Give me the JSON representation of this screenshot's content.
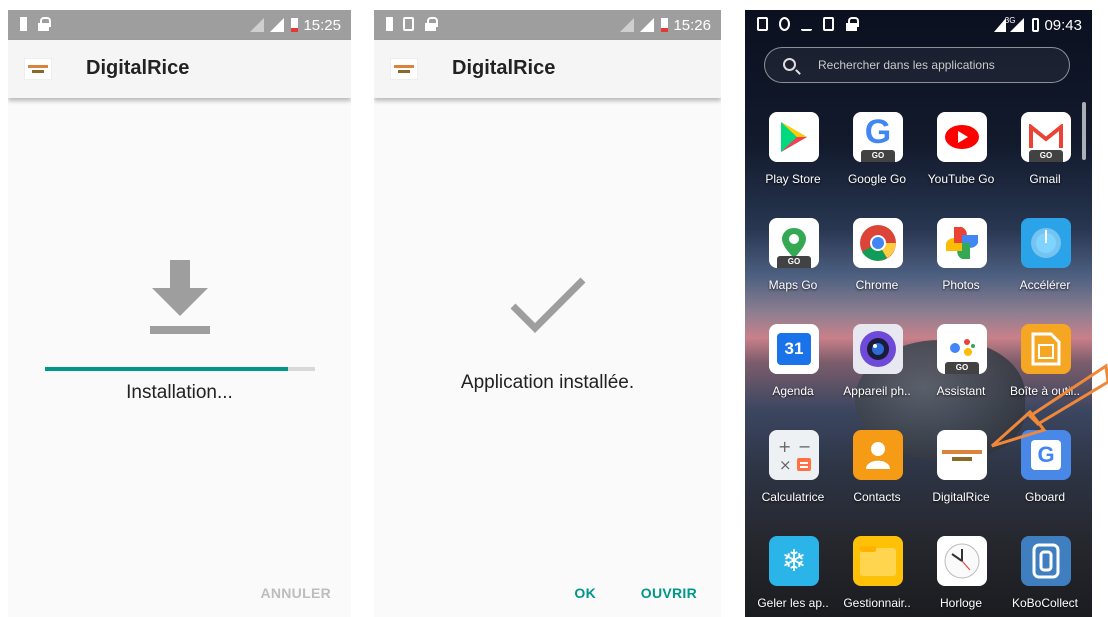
{
  "screen1": {
    "status_time": "15:25",
    "app_title": "DigitalRice",
    "status_message": "Installation...",
    "progress": 0.9,
    "cancel_label": "ANNULER"
  },
  "screen2": {
    "status_time": "15:26",
    "app_title": "DigitalRice",
    "status_message": "Application installée.",
    "ok_label": "OK",
    "open_label": "OUVRIR"
  },
  "screen3": {
    "status_time": "09:43",
    "network_label": "3G",
    "search_placeholder": "Rechercher dans les applications",
    "apps": [
      {
        "label": "Play Store",
        "icon": "play-store-icon"
      },
      {
        "label": "Google Go",
        "icon": "google-go-icon",
        "badge": "GO"
      },
      {
        "label": "YouTube Go",
        "icon": "youtube-go-icon"
      },
      {
        "label": "Gmail",
        "icon": "gmail-icon",
        "badge": "GO"
      },
      {
        "label": "Maps Go",
        "icon": "maps-go-icon",
        "badge": "GO"
      },
      {
        "label": "Chrome",
        "icon": "chrome-icon"
      },
      {
        "label": "Photos",
        "icon": "photos-icon"
      },
      {
        "label": "Accélérer",
        "icon": "accelerate-icon"
      },
      {
        "label": "Agenda",
        "icon": "calendar-icon",
        "badge": "31"
      },
      {
        "label": "Appareil ph..",
        "icon": "camera-icon"
      },
      {
        "label": "Assistant",
        "icon": "assistant-icon",
        "badge": "GO"
      },
      {
        "label": "Boîte à outil..",
        "icon": "sim-toolkit-icon"
      },
      {
        "label": "Calculatrice",
        "icon": "calculator-icon"
      },
      {
        "label": "Contacts",
        "icon": "contacts-icon"
      },
      {
        "label": "DigitalRice",
        "icon": "digitalrice-icon"
      },
      {
        "label": "Gboard",
        "icon": "gboard-icon"
      },
      {
        "label": "Geler les ap..",
        "icon": "freeze-apps-icon"
      },
      {
        "label": "Gestionnair..",
        "icon": "file-manager-icon"
      },
      {
        "label": "Horloge",
        "icon": "clock-icon"
      },
      {
        "label": "KoBoCollect",
        "icon": "kobocollect-icon"
      }
    ]
  },
  "colors": {
    "accent": "#009688",
    "status_bar": "#9e9e9e",
    "annotation_arrow": "#f0883a"
  }
}
